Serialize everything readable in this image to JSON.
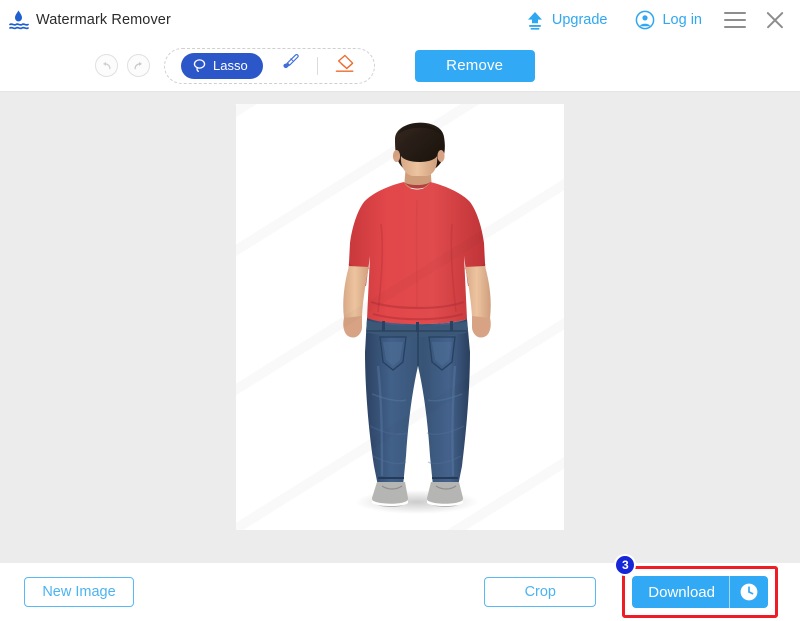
{
  "titlebar": {
    "logo_icon": "water-drop-icon",
    "title": "Watermark Remover",
    "upgrade": {
      "icon": "upload-arrow-icon",
      "label": "Upgrade"
    },
    "login": {
      "icon": "user-circle-icon",
      "label": "Log in"
    },
    "menu_icon": "hamburger-menu-icon",
    "close_icon": "close-icon"
  },
  "toolbar": {
    "undo_icon": "undo-arrow-icon",
    "redo_icon": "redo-arrow-icon",
    "tools": [
      {
        "name": "lasso",
        "label": "Lasso",
        "icon": "lasso-icon",
        "selected": true
      },
      {
        "name": "brush",
        "label": "Brush",
        "icon": "paintbrush-icon",
        "selected": false
      },
      {
        "name": "eraser",
        "label": "Eraser",
        "icon": "eraser-icon",
        "selected": false
      }
    ],
    "remove_label": "Remove"
  },
  "canvas": {
    "background_color": "#ececec",
    "image_alt": "Man standing with his back to camera wearing a red t-shirt, blue jeans and grey sneakers on white background",
    "watermark_visible": true
  },
  "footer": {
    "new_image_label": "New Image",
    "crop_label": "Crop",
    "download_label": "Download",
    "download_icon": "clock-icon",
    "step_badge": "3"
  },
  "colors": {
    "accent_blue": "#31a9f4",
    "lasso_blue": "#2b57c9",
    "eraser_orange": "#f0662a",
    "highlight_red": "#ee1c25",
    "badge_blue": "#1726d8",
    "canvas_gray": "#ececec"
  }
}
